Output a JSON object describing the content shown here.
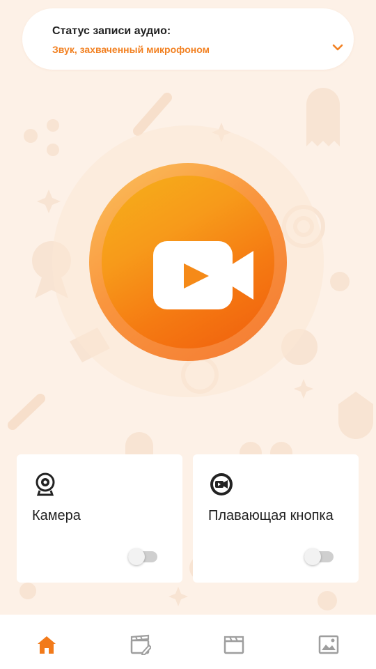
{
  "audio_status": {
    "title": "Статус записи аудио:",
    "value": "Звук, захваченный микрофоном"
  },
  "record_button": {
    "icon": "video-camera-play-icon"
  },
  "cards": {
    "camera": {
      "label": "Камера",
      "icon": "webcam-icon",
      "enabled": false
    },
    "floating_button": {
      "label": "Плавающая кнопка",
      "icon": "video-camera-circle-icon",
      "enabled": false
    }
  },
  "bottom_nav": {
    "items": [
      {
        "icon": "home-icon",
        "active": true
      },
      {
        "icon": "video-edit-icon",
        "active": false
      },
      {
        "icon": "clapperboard-icon",
        "active": false
      },
      {
        "icon": "image-icon",
        "active": false
      }
    ]
  },
  "colors": {
    "accent": "#f28122",
    "background": "#fdf1e7",
    "nav_active": "#f27a1a",
    "nav_inactive": "#9e9e9e"
  }
}
